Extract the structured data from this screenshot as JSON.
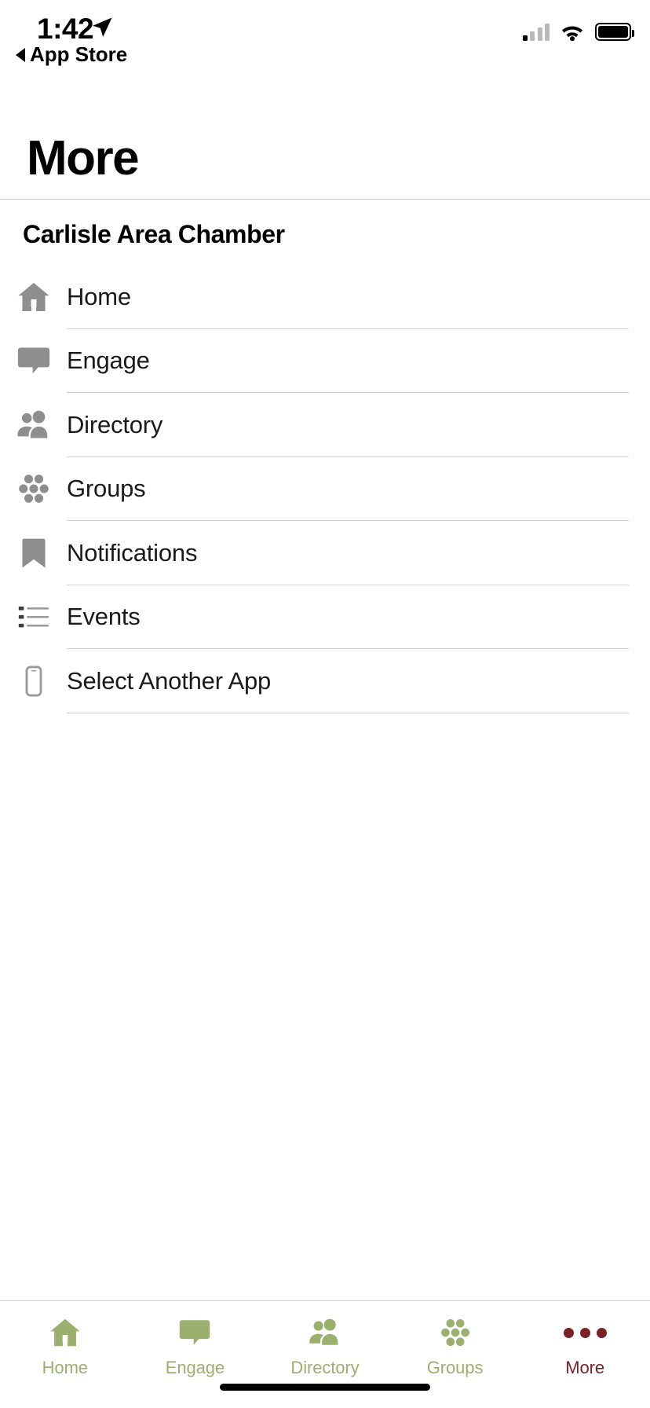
{
  "status_bar": {
    "time": "1:42",
    "location_icon": "location-arrow-icon",
    "back_label": "App Store",
    "signal_icon": "cellular-signal-icon",
    "wifi_icon": "wifi-icon",
    "battery_icon": "battery-icon"
  },
  "header": {
    "title": "More"
  },
  "section": {
    "title": "Carlisle Area Chamber"
  },
  "menu": {
    "items": [
      {
        "label": "Home",
        "icon": "home-icon"
      },
      {
        "label": "Engage",
        "icon": "speech-bubble-icon"
      },
      {
        "label": "Directory",
        "icon": "people-icon"
      },
      {
        "label": "Groups",
        "icon": "dot-cluster-icon"
      },
      {
        "label": "Notifications",
        "icon": "bookmark-icon"
      },
      {
        "label": "Events",
        "icon": "list-icon"
      },
      {
        "label": "Select Another App",
        "icon": "phone-icon"
      }
    ]
  },
  "tab_bar": {
    "active": "More",
    "items": [
      {
        "label": "Home",
        "icon": "home-icon"
      },
      {
        "label": "Engage",
        "icon": "speech-bubble-icon"
      },
      {
        "label": "Directory",
        "icon": "people-icon"
      },
      {
        "label": "Groups",
        "icon": "dot-cluster-icon"
      },
      {
        "label": "More",
        "icon": "ellipsis-icon"
      }
    ]
  },
  "colors": {
    "accent_green": "#9bb06f",
    "accent_maroon": "#7c2128",
    "icon_gray": "#8e8e8e",
    "divider": "#d2d2d2",
    "text": "#1a1a1a"
  }
}
